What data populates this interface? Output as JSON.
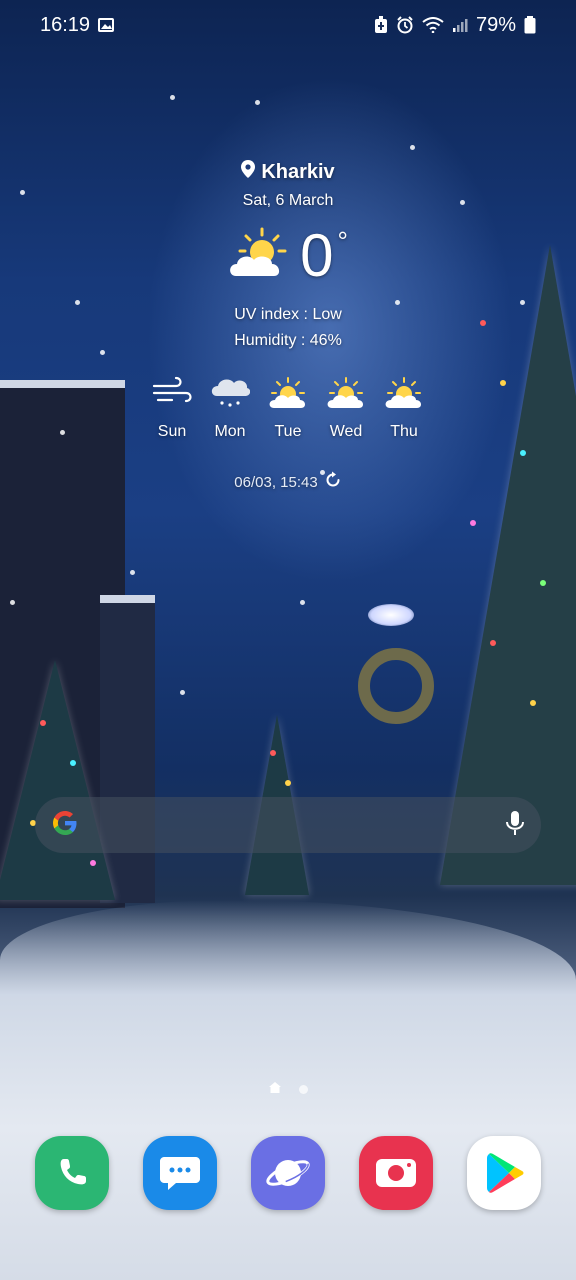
{
  "status_bar": {
    "time": "16:19",
    "battery": "79%",
    "icons": [
      "gallery-icon",
      "battery-saver-icon",
      "alarm-icon",
      "wifi-icon",
      "signal-icon",
      "battery-icon"
    ]
  },
  "weather": {
    "location": "Kharkiv",
    "date": "Sat, 6 March",
    "temperature": "0",
    "unit": "°",
    "condition_icon": "partly-sunny-icon",
    "uv": "UV index : Low",
    "humidity": "Humidity : 46%",
    "forecast": [
      {
        "day": "Sun",
        "icon": "wind-icon"
      },
      {
        "day": "Mon",
        "icon": "snow-cloud-icon"
      },
      {
        "day": "Tue",
        "icon": "partly-sunny-icon"
      },
      {
        "day": "Wed",
        "icon": "partly-sunny-icon"
      },
      {
        "day": "Thu",
        "icon": "partly-sunny-icon"
      }
    ],
    "updated": "06/03, 15:43"
  },
  "search": {
    "logo": "google-logo-icon",
    "mic": "mic-icon"
  },
  "dock": [
    {
      "name": "phone-icon",
      "color": "#2bb673"
    },
    {
      "name": "messages-icon",
      "color": "#1a8ae8"
    },
    {
      "name": "internet-icon",
      "color": "#6a6fe4"
    },
    {
      "name": "camera-icon",
      "color": "#e8334f"
    },
    {
      "name": "play-store-icon",
      "color": "#ffffff"
    }
  ]
}
